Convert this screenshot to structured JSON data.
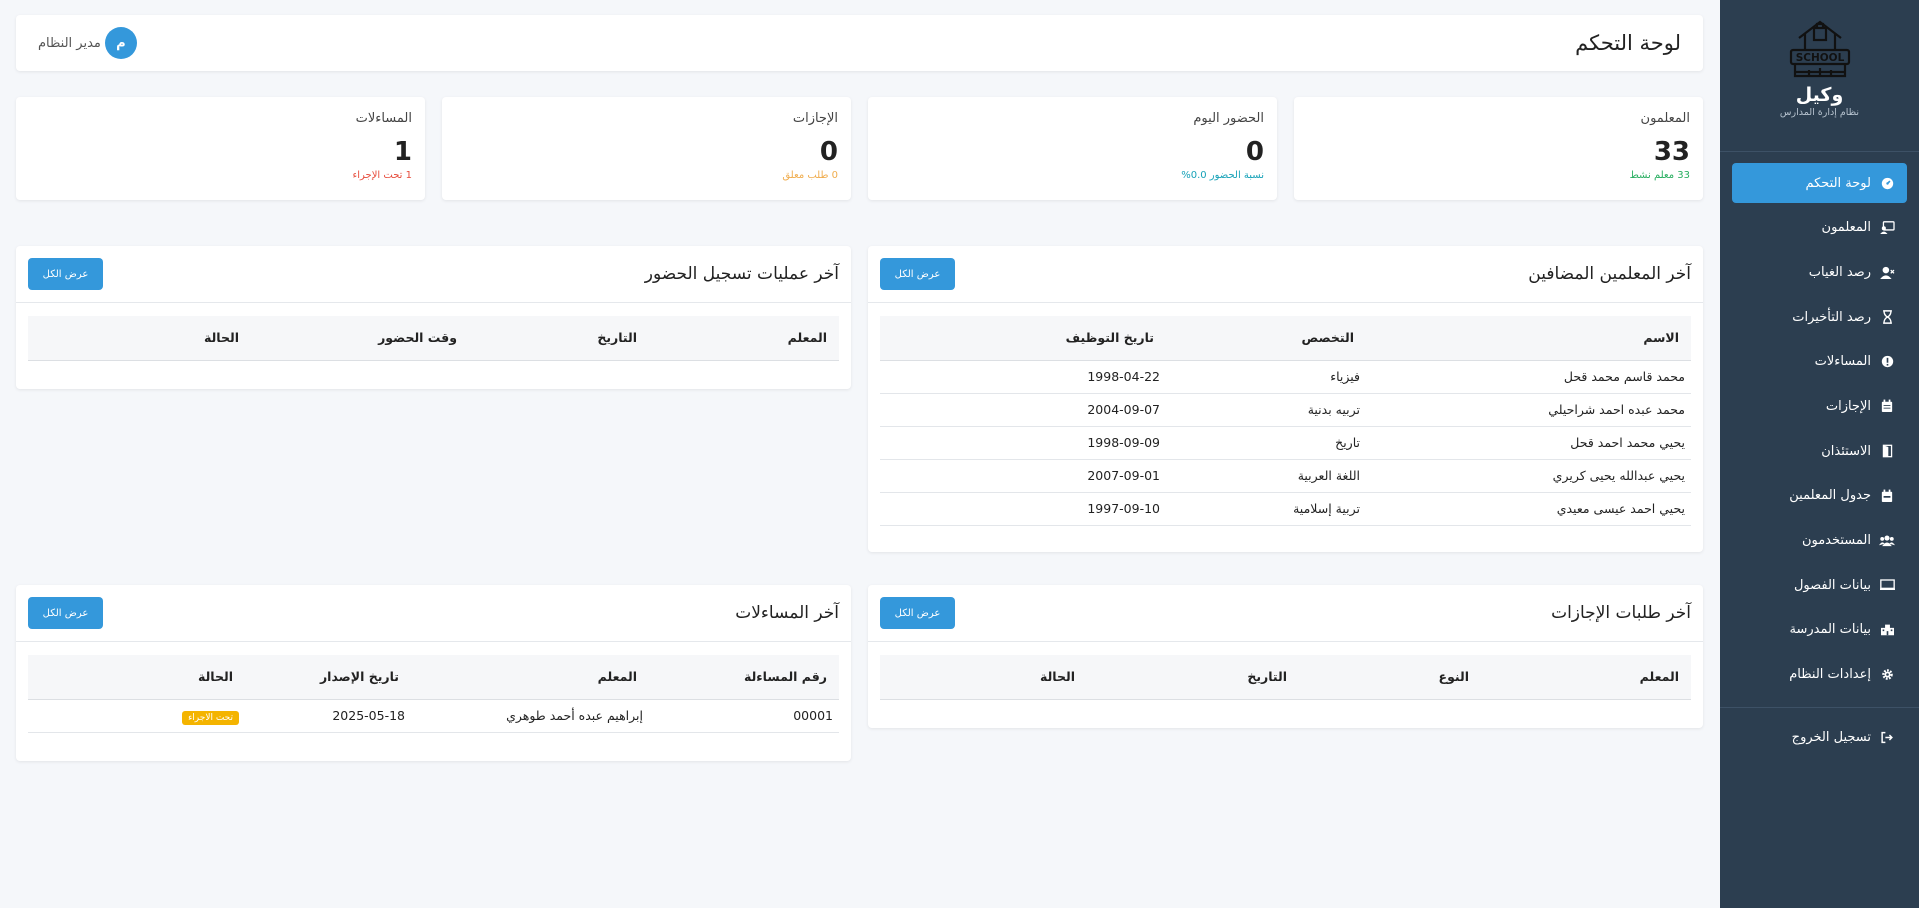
{
  "sidebar": {
    "brand_name": "وكيل",
    "brand_sub": "نظام إدارة المدارس",
    "logo_text": "SCHOOL",
    "items": [
      {
        "label": "لوحة التحكم",
        "icon": "dashboard-icon"
      },
      {
        "label": "المعلمون",
        "icon": "teacher-icon"
      },
      {
        "label": "رصد الغياب",
        "icon": "user-x-icon"
      },
      {
        "label": "رصد التأخيرات",
        "icon": "hourglass-icon"
      },
      {
        "label": "المساءلات",
        "icon": "alert-icon"
      },
      {
        "label": "الإجازات",
        "icon": "calendar-icon"
      },
      {
        "label": "الاستئذان",
        "icon": "door-icon"
      },
      {
        "label": "جدول المعلمين",
        "icon": "schedule-icon"
      },
      {
        "label": "المستخدمون",
        "icon": "users-icon"
      },
      {
        "label": "بيانات الفصول",
        "icon": "classroom-icon"
      },
      {
        "label": "بيانات المدرسة",
        "icon": "school-icon"
      },
      {
        "label": "إعدادات النظام",
        "icon": "gear-icon"
      }
    ],
    "logout": "تسجيل الخروج"
  },
  "topbar": {
    "title": "لوحة التحكم",
    "user_name": "مدير النظام",
    "avatar_letter": "م"
  },
  "stats": [
    {
      "title": "المعلمون",
      "value": "33",
      "sub": "33 معلم نشط",
      "color": "#27ae60"
    },
    {
      "title": "الحضور اليوم",
      "value": "0",
      "sub": "نسبة الحضور 0.0%",
      "color": "#17a2b8"
    },
    {
      "title": "الإجازات",
      "value": "0",
      "sub": "0 طلب معلق",
      "color": "#f0ad4e"
    },
    {
      "title": "المساءلات",
      "value": "1",
      "sub": "1 تحت الإجراء",
      "color": "#e74c3c"
    }
  ],
  "view_all_label": "عرض الكل",
  "teachers_card": {
    "title": "آخر المعلمين المضافين",
    "headers": [
      "الاسم",
      "التخصص",
      "تاريخ التوظيف"
    ],
    "rows": [
      [
        "محمد قاسم محمد قحل",
        "فيزياء",
        "1998-04-22"
      ],
      [
        "محمد عبده احمد شراحيلي",
        "تربيه بدنية",
        "2004-09-07"
      ],
      [
        "يحيي محمد احمد قحل",
        "تاريخ",
        "1998-09-09"
      ],
      [
        "يحيي عبدالله يحيى كريري",
        "اللغة العربية",
        "2007-09-01"
      ],
      [
        "يحيي احمد عيسى معيدي",
        "تربية إسلامية",
        "1997-09-10"
      ]
    ]
  },
  "attendance_card": {
    "title": "آخر عمليات تسجيل الحضور",
    "headers": [
      "المعلم",
      "التاريخ",
      "وقت الحضور",
      "الحالة"
    ]
  },
  "leaves_card": {
    "title": "آخر طلبات الإجازات",
    "headers": [
      "المعلم",
      "النوع",
      "التاريخ",
      "الحالة"
    ]
  },
  "accountability_card": {
    "title": "آخر المساءلات",
    "headers": [
      "رقم المساءلة",
      "المعلم",
      "تاريخ الإصدار",
      "الحالة"
    ],
    "rows": [
      {
        "number": "00001",
        "teacher": "إبراهيم عبده أحمد طوهري",
        "date": "2025-05-18",
        "status": "تحت الاجراء"
      }
    ]
  },
  "colors": {
    "sidebar_bg": "#2c3e50",
    "accent": "#3498db",
    "page_bg": "#f5f7fa",
    "badge_warning": "#f4b400"
  }
}
